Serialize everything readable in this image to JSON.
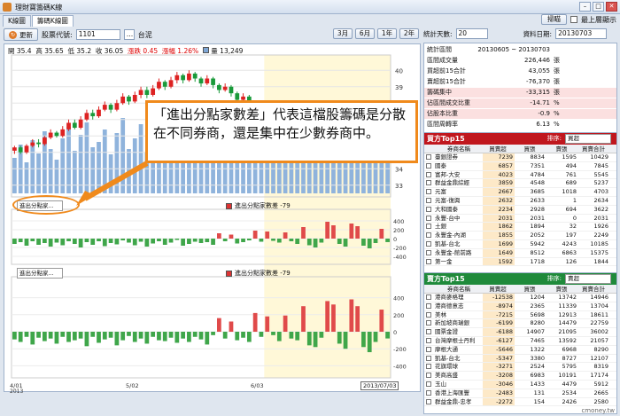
{
  "window": {
    "title": "理財寶籌碼K線"
  },
  "tabs": [
    {
      "label": "K線圖"
    },
    {
      "label": "籌碼K線圖"
    }
  ],
  "top_controls": {
    "scan_label": "掃瞄",
    "always_on_top_label": "最上層顯示"
  },
  "toolbar": {
    "refresh_label": "更新",
    "symbol_label": "股票代號:",
    "symbol_value": "1101",
    "symbol_name": "台泥",
    "periods": [
      "3月",
      "6月",
      "1年",
      "2年"
    ]
  },
  "quote": {
    "open": "開 35.4",
    "high": "高 35.65",
    "low": "低 35.2",
    "close": "收 36.05",
    "change": "漲跌 0.45",
    "pct": "漲幅 1.26%",
    "volume": "量 13,249"
  },
  "panes": [
    {
      "select": "進出分點家...",
      "legend": "進出分點家數差 -79"
    },
    {
      "select": "進出分點家...",
      "legend": "進出分點家數差 -79"
    }
  ],
  "axis": {
    "price_ticks": [
      "40",
      "39",
      "38",
      "37",
      "36",
      "35",
      "34",
      "33"
    ],
    "diff_ticks": [
      "400",
      "200",
      "0",
      "-200",
      "-400"
    ],
    "x_ticks": [
      "4/01",
      "5/02",
      "6/03"
    ],
    "x_year": "2013",
    "cursor_date": "2013/07/03"
  },
  "callout": {
    "text": "「進出分點家數差」代表這檔股籌碼是分散在不同券商，還是集中在少數券商中。"
  },
  "right_panel": {
    "stat_days_label": "統計天數:",
    "stat_days_value": "20",
    "data_date_label": "資料日期:",
    "data_date_value": "20130703",
    "stats": [
      {
        "label": "統計區間",
        "value": "20130605 ~ 20130703",
        "unit": "",
        "highlight": false
      },
      {
        "label": "區間成交量",
        "value": "226,446",
        "unit": "張",
        "highlight": false
      },
      {
        "label": "買超前15合計",
        "value": "43,055",
        "unit": "張",
        "highlight": false
      },
      {
        "label": "賣超前15合計",
        "value": "-76,370",
        "unit": "張",
        "highlight": false
      },
      {
        "label": "籌碼集中",
        "value": "-33,315",
        "unit": "張",
        "highlight": true
      },
      {
        "label": "佔區間成交比重",
        "value": "-14.71",
        "unit": "%",
        "highlight": true
      },
      {
        "label": "佔股本比重",
        "value": "-0.9",
        "unit": "%",
        "highlight": true
      },
      {
        "label": "區間周轉率",
        "value": "6.13",
        "unit": "%",
        "highlight": false
      }
    ],
    "buy": {
      "title": "買方Top15",
      "sort_label": "排序:",
      "sort_value": "買超",
      "color": "#c0171e",
      "columns": [
        "券商名稱",
        "買賣超",
        "買張",
        "賣張",
        "買賣合計"
      ],
      "rows": [
        [
          "臺銀證券",
          "7239",
          "8834",
          "1595",
          "10429"
        ],
        [
          "國泰",
          "6857",
          "7351",
          "494",
          "7845"
        ],
        [
          "富邦-大安",
          "4023",
          "4784",
          "761",
          "5545"
        ],
        [
          "群益金鼎綜經",
          "3859",
          "4548",
          "689",
          "5237"
        ],
        [
          "元富",
          "2667",
          "3685",
          "1018",
          "4703"
        ],
        [
          "元富-復興",
          "2632",
          "2633",
          "1",
          "2634"
        ],
        [
          "大和國泰",
          "2234",
          "2928",
          "694",
          "3622"
        ],
        [
          "永豐-台中",
          "2031",
          "2031",
          "0",
          "2031"
        ],
        [
          "土銀",
          "1862",
          "1894",
          "32",
          "1926"
        ],
        [
          "永豐金-內湖",
          "1855",
          "2052",
          "197",
          "2249"
        ],
        [
          "凱基-台北",
          "1699",
          "5942",
          "4243",
          "10185"
        ],
        [
          "永豐金-館前路",
          "1649",
          "8512",
          "6863",
          "15375"
        ],
        [
          "第一金",
          "1592",
          "1718",
          "126",
          "1844"
        ]
      ]
    },
    "sell": {
      "title": "賣方Top15",
      "sort_label": "排序:",
      "sort_value": "賣超",
      "color": "#1f8a3b",
      "columns": [
        "券商名稱",
        "買賣超",
        "買張",
        "賣張",
        "買賣合計"
      ],
      "rows": [
        [
          "港商麥格理",
          "-12538",
          "1204",
          "13742",
          "14946"
        ],
        [
          "港商德意志",
          "-8974",
          "2365",
          "11339",
          "13704"
        ],
        [
          "美林",
          "-7215",
          "5698",
          "12913",
          "18611"
        ],
        [
          "新加坡商瑞銀",
          "-6199",
          "8280",
          "14479",
          "22759"
        ],
        [
          "國票金證",
          "-6188",
          "14907",
          "21095",
          "36002"
        ],
        [
          "台灣摩根士丹利",
          "-6127",
          "7465",
          "13592",
          "21057"
        ],
        [
          "摩根大通",
          "-5646",
          "1322",
          "6968",
          "8290"
        ],
        [
          "凱基-台北",
          "-5347",
          "3380",
          "8727",
          "12107"
        ],
        [
          "花旗環球",
          "-3271",
          "2524",
          "5795",
          "8319"
        ],
        [
          "美商高盛",
          "-3208",
          "6983",
          "10191",
          "17174"
        ],
        [
          "玉山",
          "-3046",
          "1433",
          "4479",
          "5912"
        ],
        [
          "香港上海匯豐",
          "-2483",
          "131",
          "2534",
          "2665"
        ],
        [
          "群益金鼎-忠孝",
          "-2272",
          "154",
          "2426",
          "2580"
        ]
      ]
    }
  },
  "watermark": "cmoney.tw",
  "chart_data": {
    "type": "candlestick",
    "price_ylim": [
      32.5,
      40.5
    ],
    "x_labels": [
      "4/01",
      "5/02",
      "6/03"
    ],
    "candles": [
      [
        35.1,
        35.3,
        34.9,
        35.4
      ],
      [
        35.3,
        35.0,
        34.9,
        35.4
      ],
      [
        35.0,
        35.4,
        34.9,
        35.5
      ],
      [
        35.4,
        35.6,
        35.3,
        35.8
      ],
      [
        35.6,
        35.5,
        35.3,
        35.8
      ],
      [
        35.5,
        35.9,
        35.4,
        36.0
      ],
      [
        35.9,
        36.2,
        35.8,
        36.4
      ],
      [
        36.2,
        36.0,
        35.9,
        36.3
      ],
      [
        36.0,
        36.4,
        35.9,
        36.6
      ],
      [
        36.4,
        36.8,
        36.3,
        37.0
      ],
      [
        36.8,
        36.5,
        36.4,
        37.0
      ],
      [
        36.5,
        37.0,
        36.4,
        37.2
      ],
      [
        37.0,
        37.4,
        36.9,
        37.6
      ],
      [
        37.4,
        37.2,
        37.0,
        37.6
      ],
      [
        37.2,
        37.6,
        37.1,
        37.8
      ],
      [
        37.6,
        37.9,
        37.5,
        38.1
      ],
      [
        37.9,
        37.6,
        37.4,
        38.0
      ],
      [
        37.6,
        38.0,
        37.5,
        38.2
      ],
      [
        38.0,
        38.4,
        37.9,
        38.6
      ],
      [
        38.4,
        38.1,
        37.9,
        38.5
      ],
      [
        38.1,
        38.5,
        38.0,
        38.7
      ],
      [
        38.5,
        38.8,
        38.3,
        39.0
      ],
      [
        38.8,
        38.5,
        38.3,
        39.0
      ],
      [
        38.5,
        38.9,
        38.4,
        39.1
      ],
      [
        38.9,
        39.3,
        38.8,
        39.5
      ],
      [
        39.3,
        39.0,
        38.8,
        39.4
      ],
      [
        39.0,
        39.4,
        38.9,
        39.6
      ],
      [
        39.4,
        39.7,
        39.2,
        39.9
      ],
      [
        39.7,
        39.4,
        39.2,
        39.8
      ],
      [
        39.4,
        39.8,
        39.3,
        40.0
      ],
      [
        39.8,
        39.5,
        39.3,
        39.9
      ],
      [
        39.5,
        39.2,
        39.0,
        39.6
      ],
      [
        39.2,
        39.5,
        39.1,
        39.7
      ],
      [
        39.5,
        39.1,
        38.9,
        39.6
      ],
      [
        39.1,
        38.8,
        38.6,
        39.2
      ],
      [
        38.8,
        39.0,
        38.7,
        39.2
      ],
      [
        39.0,
        38.6,
        38.4,
        39.1
      ],
      [
        38.6,
        38.2,
        38.0,
        38.7
      ],
      [
        38.2,
        38.4,
        38.1,
        38.6
      ],
      [
        38.4,
        38.0,
        37.8,
        38.5
      ],
      [
        38.0,
        37.7,
        37.5,
        38.1
      ],
      [
        37.7,
        37.9,
        37.6,
        38.1
      ],
      [
        37.9,
        37.5,
        37.3,
        38.0
      ],
      [
        37.5,
        37.1,
        36.9,
        37.6
      ],
      [
        37.1,
        37.3,
        37.0,
        37.5
      ],
      [
        37.3,
        36.9,
        36.7,
        37.4
      ],
      [
        36.9,
        36.5,
        36.3,
        37.0
      ],
      [
        36.5,
        36.7,
        36.4,
        36.9
      ],
      [
        36.7,
        36.3,
        36.1,
        36.8
      ],
      [
        36.3,
        35.9,
        35.7,
        36.4
      ],
      [
        35.9,
        35.6,
        35.4,
        36.0
      ],
      [
        35.6,
        35.2,
        35.0,
        35.7
      ],
      [
        35.2,
        35.0,
        34.7,
        35.3
      ],
      [
        35.0,
        34.7,
        34.5,
        35.1
      ],
      [
        34.7,
        34.9,
        34.6,
        35.1
      ],
      [
        34.9,
        35.3,
        34.8,
        35.5
      ],
      [
        35.3,
        35.0,
        34.9,
        35.4
      ],
      [
        35.0,
        35.6,
        34.9,
        35.7
      ],
      [
        35.6,
        35.3,
        35.2,
        35.7
      ],
      [
        35.3,
        35.8,
        35.2,
        35.9
      ],
      [
        35.8,
        35.5,
        35.3,
        35.9
      ],
      [
        35.5,
        35.9,
        35.4,
        36.0
      ],
      [
        35.6,
        36.05,
        35.2,
        36.1
      ]
    ],
    "volume": [
      40,
      55,
      35,
      60,
      45,
      70,
      50,
      38,
      62,
      75,
      48,
      66,
      80,
      52,
      58,
      72,
      44,
      68,
      85,
      50,
      62,
      78,
      46,
      70,
      88,
      54,
      66,
      82,
      48,
      74,
      60,
      45,
      58,
      50,
      42,
      55,
      48,
      40,
      52,
      45,
      38,
      50,
      44,
      36,
      48,
      42,
      35,
      46,
      40,
      38,
      45,
      42,
      60,
      55,
      50,
      58,
      44,
      62,
      48,
      56,
      52,
      60,
      95
    ],
    "diff_series": [
      {
        "name": "進出分點家數差",
        "values": [
          -120,
          -80,
          -160,
          -60,
          -140,
          -100,
          -180,
          -90,
          -150,
          -60,
          -120,
          -200,
          -80,
          -140,
          -60,
          -170,
          -100,
          -130,
          -40,
          -90,
          -150,
          -70,
          -180,
          -110,
          -60,
          -140,
          -90,
          -30,
          -160,
          -120,
          -70,
          -100,
          -80,
          -140,
          120,
          -60,
          90,
          -110,
          -80,
          -40,
          180,
          -70,
          160,
          -50,
          -90,
          140,
          -60,
          -120,
          260,
          -150,
          -200,
          -90,
          380,
          300,
          -120,
          -180,
          340,
          280,
          -160,
          -220,
          -100,
          220,
          -79
        ]
      },
      {
        "name": "進出分點家數差",
        "values": [
          -90,
          -120,
          -60,
          -150,
          -70,
          -110,
          -80,
          -140,
          -60,
          -120,
          -100,
          -80,
          -170,
          -60,
          -130,
          -90,
          -70,
          -160,
          -100,
          -50,
          -120,
          -80,
          -140,
          -60,
          -100,
          -110,
          -70,
          -130,
          -80,
          -120,
          -60,
          -90,
          -150,
          -40,
          160,
          -80,
          120,
          -100,
          -70,
          -120,
          220,
          -60,
          180,
          -40,
          -110,
          190,
          -80,
          -100,
          300,
          -160,
          -180,
          -70,
          360,
          320,
          -140,
          -200,
          380,
          300,
          -180,
          -240,
          -120,
          260,
          -79
        ]
      }
    ],
    "diff_ylim": [
      -500,
      500
    ]
  }
}
